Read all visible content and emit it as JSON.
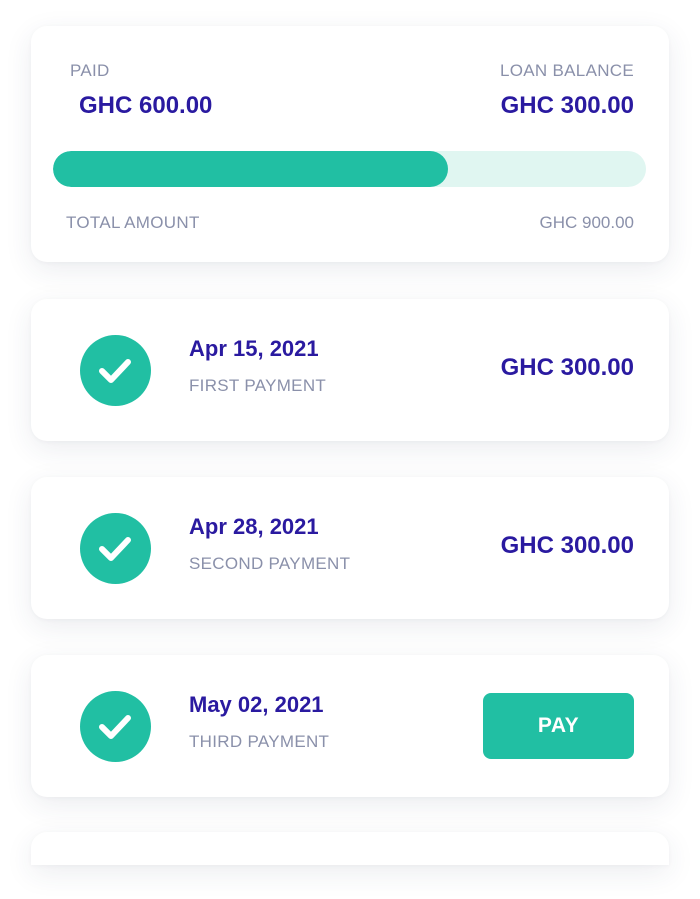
{
  "summary": {
    "paid_label": "PAID",
    "paid_amount": "GHC 600.00",
    "balance_label": "LOAN BALANCE",
    "balance_amount": "GHC 300.00",
    "progress_fraction": 0.6667,
    "total_label": "TOTAL AMOUNT",
    "total_amount": "GHC 900.00"
  },
  "payments": [
    {
      "date": "Apr 15, 2021",
      "label": "FIRST PAYMENT",
      "amount": "GHC 300.00",
      "status_icon": "check-icon"
    },
    {
      "date": "Apr 28, 2021",
      "label": "SECOND PAYMENT",
      "amount": "GHC 300.00",
      "status_icon": "check-icon"
    },
    {
      "date": "May 02, 2021",
      "label": "THIRD PAYMENT",
      "button_label": "PAY",
      "status_icon": "check-icon"
    }
  ],
  "colors": {
    "accent": "#21bfa3",
    "track": "#e0f6f1",
    "amount_text": "#2a1aa0",
    "label_text": "#8a90aa"
  }
}
